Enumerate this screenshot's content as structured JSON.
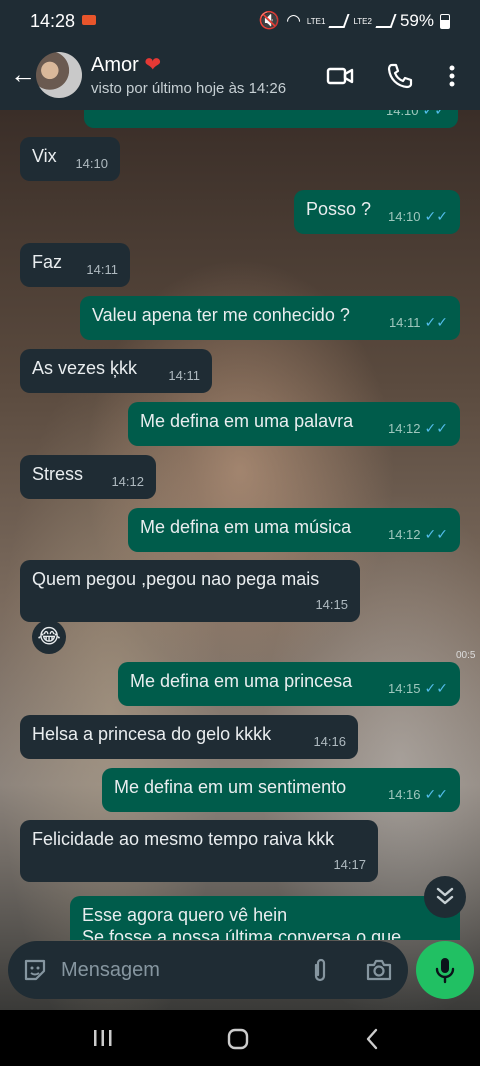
{
  "status_bar": {
    "time": "14:28",
    "battery": "59%",
    "sim1": "LTE1",
    "sim2": "LTE2"
  },
  "header": {
    "contact_name": "Amor",
    "heart": "❤",
    "last_seen": "visto por último hoje às 14:26"
  },
  "messages": [
    {
      "dir": "out",
      "text": "",
      "time": "14:10",
      "read": true
    },
    {
      "dir": "in",
      "text": "Vix",
      "time": "14:10"
    },
    {
      "dir": "out",
      "text": "Posso ?",
      "time": "14:10",
      "read": true
    },
    {
      "dir": "in",
      "text": "Faz",
      "time": "14:11"
    },
    {
      "dir": "out",
      "text": "Valeu apena ter me conhecido ?",
      "time": "14:11",
      "read": true
    },
    {
      "dir": "in",
      "text": "As vezes ķkk",
      "time": "14:11"
    },
    {
      "dir": "out",
      "text": "Me defina em uma palavra",
      "time": "14:12",
      "read": true
    },
    {
      "dir": "in",
      "text": "Stress",
      "time": "14:12"
    },
    {
      "dir": "out",
      "text": "Me defina em uma música",
      "time": "14:12",
      "read": true
    },
    {
      "dir": "in",
      "text": "Quem pegou ,pegou nao pega mais",
      "time": "14:15"
    },
    {
      "dir": "out",
      "text": "Me defina em uma princesa",
      "time": "14:15",
      "read": true
    },
    {
      "dir": "in",
      "text": "Helsa a princesa do gelo kkkk",
      "time": "14:16"
    },
    {
      "dir": "out",
      "text": "Me defina em um sentimento",
      "time": "14:16",
      "read": true
    },
    {
      "dir": "in",
      "text": "Felicidade ao mesmo tempo raiva kkk",
      "time": "14:17"
    },
    {
      "dir": "out",
      "text": "Esse agora quero vê hein\nSe fosse a nossa última conversa o que",
      "time": "",
      "read": false
    }
  ],
  "reaction": {
    "emoji": "😂"
  },
  "overlay_text": "00:5",
  "composer": {
    "placeholder": "Mensagem"
  },
  "ticks": "✓✓",
  "colors": {
    "incoming": "#1f2c34",
    "outgoing": "#005c4b",
    "accent": "#21c063",
    "read_tick": "#53bdeb"
  }
}
